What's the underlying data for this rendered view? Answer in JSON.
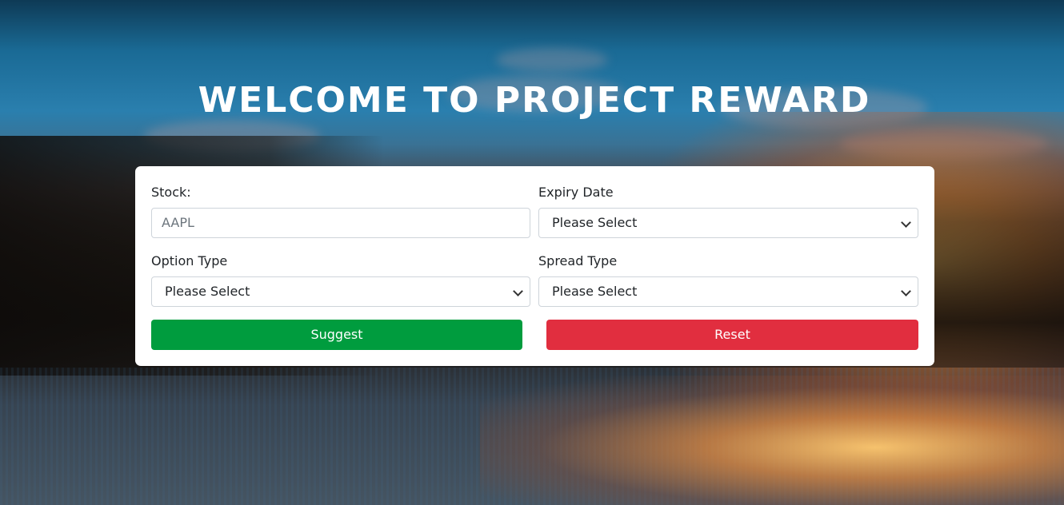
{
  "header": {
    "title": "WELCOME TO PROJECT REWARD"
  },
  "form": {
    "stock": {
      "label": "Stock:",
      "placeholder": "AAPL"
    },
    "expiry_date": {
      "label": "Expiry Date",
      "selected": "Please Select"
    },
    "option_type": {
      "label": "Option Type",
      "selected": "Please Select"
    },
    "spread_type": {
      "label": "Spread Type",
      "selected": "Please Select"
    },
    "suggest_label": "Suggest",
    "reset_label": "Reset"
  },
  "colors": {
    "suggest": "#009c3e",
    "reset": "#e12e3f",
    "card": "#ffffff"
  },
  "icons": {
    "select_arrow": "chevron-down-icon"
  }
}
